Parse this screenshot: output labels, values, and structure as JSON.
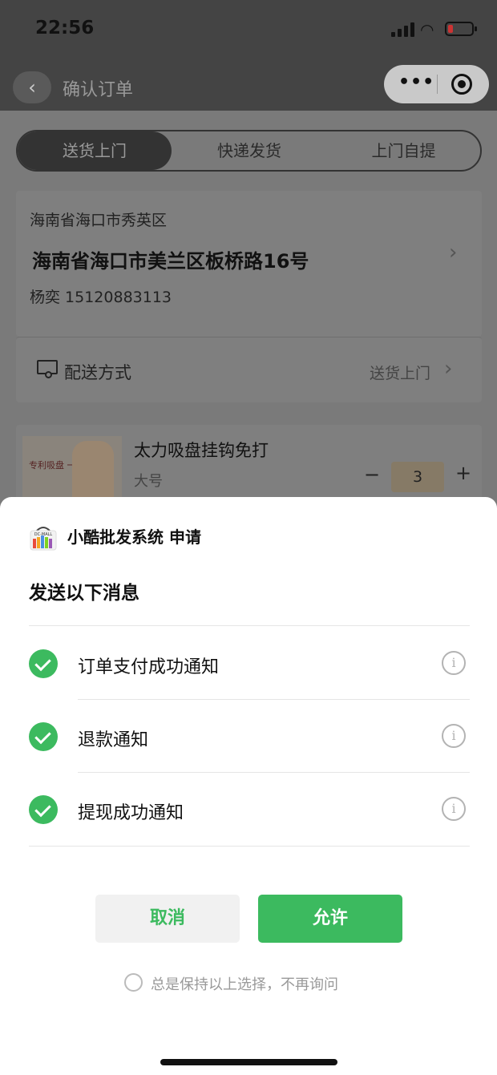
{
  "status_bar": {
    "time": "22:56"
  },
  "nav": {
    "title": "确认订单",
    "back_icon": "chevron-left-icon",
    "more_icon": "more-dots-icon",
    "close_icon": "target-icon"
  },
  "page": {
    "delivery_tabs": [
      "送货上门",
      "快递发货",
      "上门自提"
    ],
    "active_tab": "送货上门",
    "address": {
      "region": "海南省海口市秀英区",
      "detail": "海南省海口市美兰区板桥路16号",
      "contact": "杨奕 15120883113"
    },
    "shipping": {
      "label": "配送方式",
      "value": "送货上门"
    },
    "product": {
      "name": "太力吸盘挂钩免打",
      "spec": "大号",
      "quantity": "3",
      "minus": "−",
      "plus": "+",
      "image_text": "专利吸盘 一秒安装"
    }
  },
  "sheet": {
    "app_name": "小酷批发系统 申请",
    "logo_text": "DC-MALL",
    "title": "发送以下消息",
    "messages": [
      {
        "label": "订单支付成功通知",
        "checked": true
      },
      {
        "label": "退款通知",
        "checked": true
      },
      {
        "label": "提现成功通知",
        "checked": true
      }
    ],
    "info_icon_text": "i",
    "cancel_label": "取消",
    "allow_label": "允许",
    "keep_choice_label": "总是保持以上选择，不再询问",
    "accent_color": "#3cba5f"
  }
}
